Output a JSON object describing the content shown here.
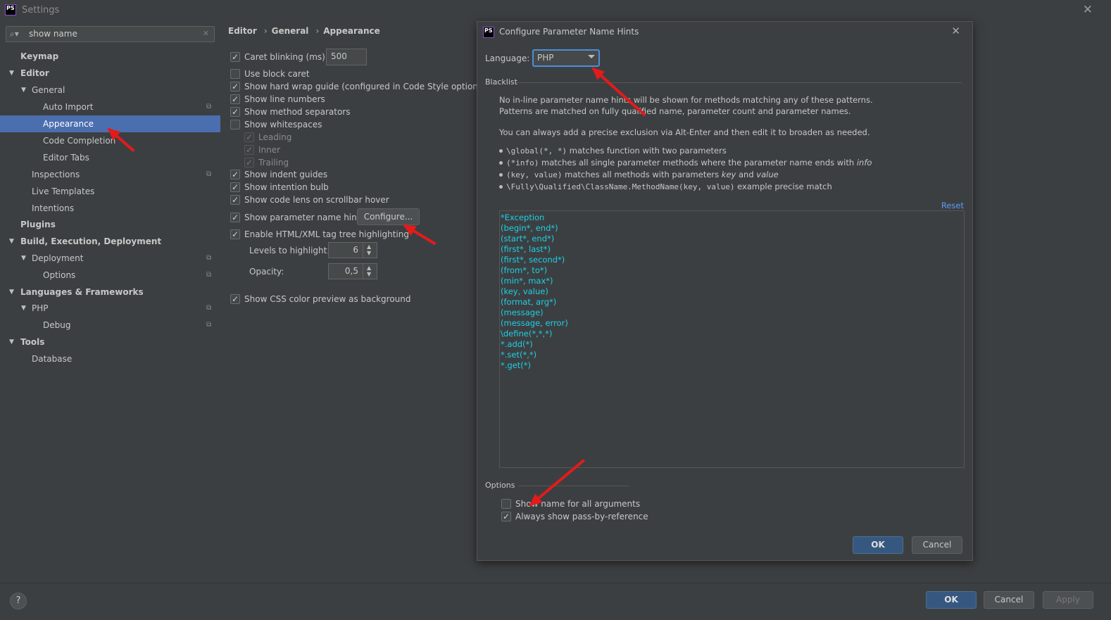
{
  "window": {
    "title": "Settings",
    "app_icon": "PS"
  },
  "sidebar": {
    "search_value": "show name",
    "items": [
      {
        "label": "Keymap"
      },
      {
        "label": "Editor"
      },
      {
        "label": "General"
      },
      {
        "label": "Auto Import"
      },
      {
        "label": "Appearance"
      },
      {
        "label": "Code Completion"
      },
      {
        "label": "Editor Tabs"
      },
      {
        "label": "Inspections"
      },
      {
        "label": "Live Templates"
      },
      {
        "label": "Intentions"
      },
      {
        "label": "Plugins"
      },
      {
        "label": "Build, Execution, Deployment"
      },
      {
        "label": "Deployment"
      },
      {
        "label": "Options"
      },
      {
        "label": "Languages & Frameworks"
      },
      {
        "label": "PHP"
      },
      {
        "label": "Debug"
      },
      {
        "label": "Tools"
      },
      {
        "label": "Database"
      }
    ]
  },
  "breadcrumb": {
    "a": "Editor",
    "b": "General",
    "c": "Appearance",
    "sep": "›"
  },
  "settings": {
    "caret_blinking": {
      "label": "Caret blinking (ms):",
      "value": "500",
      "checked": true
    },
    "use_block_caret": {
      "label": "Use block caret",
      "checked": false
    },
    "hard_wrap": {
      "label": "Show hard wrap guide (configured in Code Style options)",
      "checked": true
    },
    "line_numbers": {
      "label": "Show line numbers",
      "checked": true
    },
    "method_separators": {
      "label": "Show method separators",
      "checked": true
    },
    "whitespaces": {
      "label": "Show whitespaces",
      "checked": false
    },
    "leading": {
      "label": "Leading"
    },
    "inner": {
      "label": "Inner"
    },
    "trailing": {
      "label": "Trailing"
    },
    "indent_guides": {
      "label": "Show indent guides",
      "checked": true
    },
    "intention_bulb": {
      "label": "Show intention bulb",
      "checked": true
    },
    "code_lens": {
      "label": "Show code lens on scrollbar hover",
      "checked": true
    },
    "param_hints": {
      "label": "Show parameter name hints",
      "checked": true
    },
    "configure_label": "Configure...",
    "tag_tree": {
      "label": "Enable HTML/XML tag tree highlighting",
      "checked": true
    },
    "levels_label": "Levels to highlight:",
    "levels_value": "6",
    "opacity_label": "Opacity:",
    "opacity_value": "0,5",
    "css_preview": {
      "label": "Show CSS color preview as background",
      "checked": true
    }
  },
  "dialog": {
    "title": "Configure Parameter Name Hints",
    "app_icon": "PS",
    "language_label": "Language:",
    "language_value": "PHP",
    "blacklist_title": "Blacklist",
    "desc1": "No in-line parameter name hints will be shown for methods matching any of these patterns.",
    "desc2": "Patterns are matched on fully qualified name, parameter count and parameter names.",
    "desc3": "You can always add a precise exclusion via Alt-Enter and then edit it to broaden as needed.",
    "examples": [
      {
        "code": "\\global(*, *)",
        "text": " matches function with two parameters"
      },
      {
        "code": "(*info)",
        "text": " matches all single parameter methods where the parameter name ends with ",
        "em": "info"
      },
      {
        "code": "(key, value)",
        "text": " matches all methods with parameters ",
        "em": "key",
        "text2": " and ",
        "em2": "value"
      },
      {
        "code": "\\Fully\\Qualified\\ClassName.MethodName(key, value)",
        "text": " example precise match"
      }
    ],
    "reset_label": "Reset",
    "patterns": [
      "*Exception",
      "(begin*, end*)",
      "(start*, end*)",
      "(first*, last*)",
      "(first*, second*)",
      "(from*, to*)",
      "(min*, max*)",
      "(key, value)",
      "(format, arg*)",
      "(message)",
      "(message, error)",
      "\\define(*,*,*)",
      "*.add(*)",
      "*.set(*,*)",
      "*.get(*)"
    ],
    "options_title": "Options",
    "opt_show_name": {
      "label": "Show name for all arguments",
      "checked": false
    },
    "opt_pass_ref": {
      "label": "Always show pass-by-reference",
      "checked": true
    },
    "ok_label": "OK",
    "cancel_label": "Cancel"
  },
  "footer": {
    "help": "?",
    "ok_label": "OK",
    "cancel_label": "Cancel",
    "apply_label": "Apply"
  },
  "colors": {
    "selection": "#4b6eaf",
    "pattern_text": "#1ecfe6",
    "link": "#589df6",
    "annotation_arrow": "#e31b1b"
  }
}
